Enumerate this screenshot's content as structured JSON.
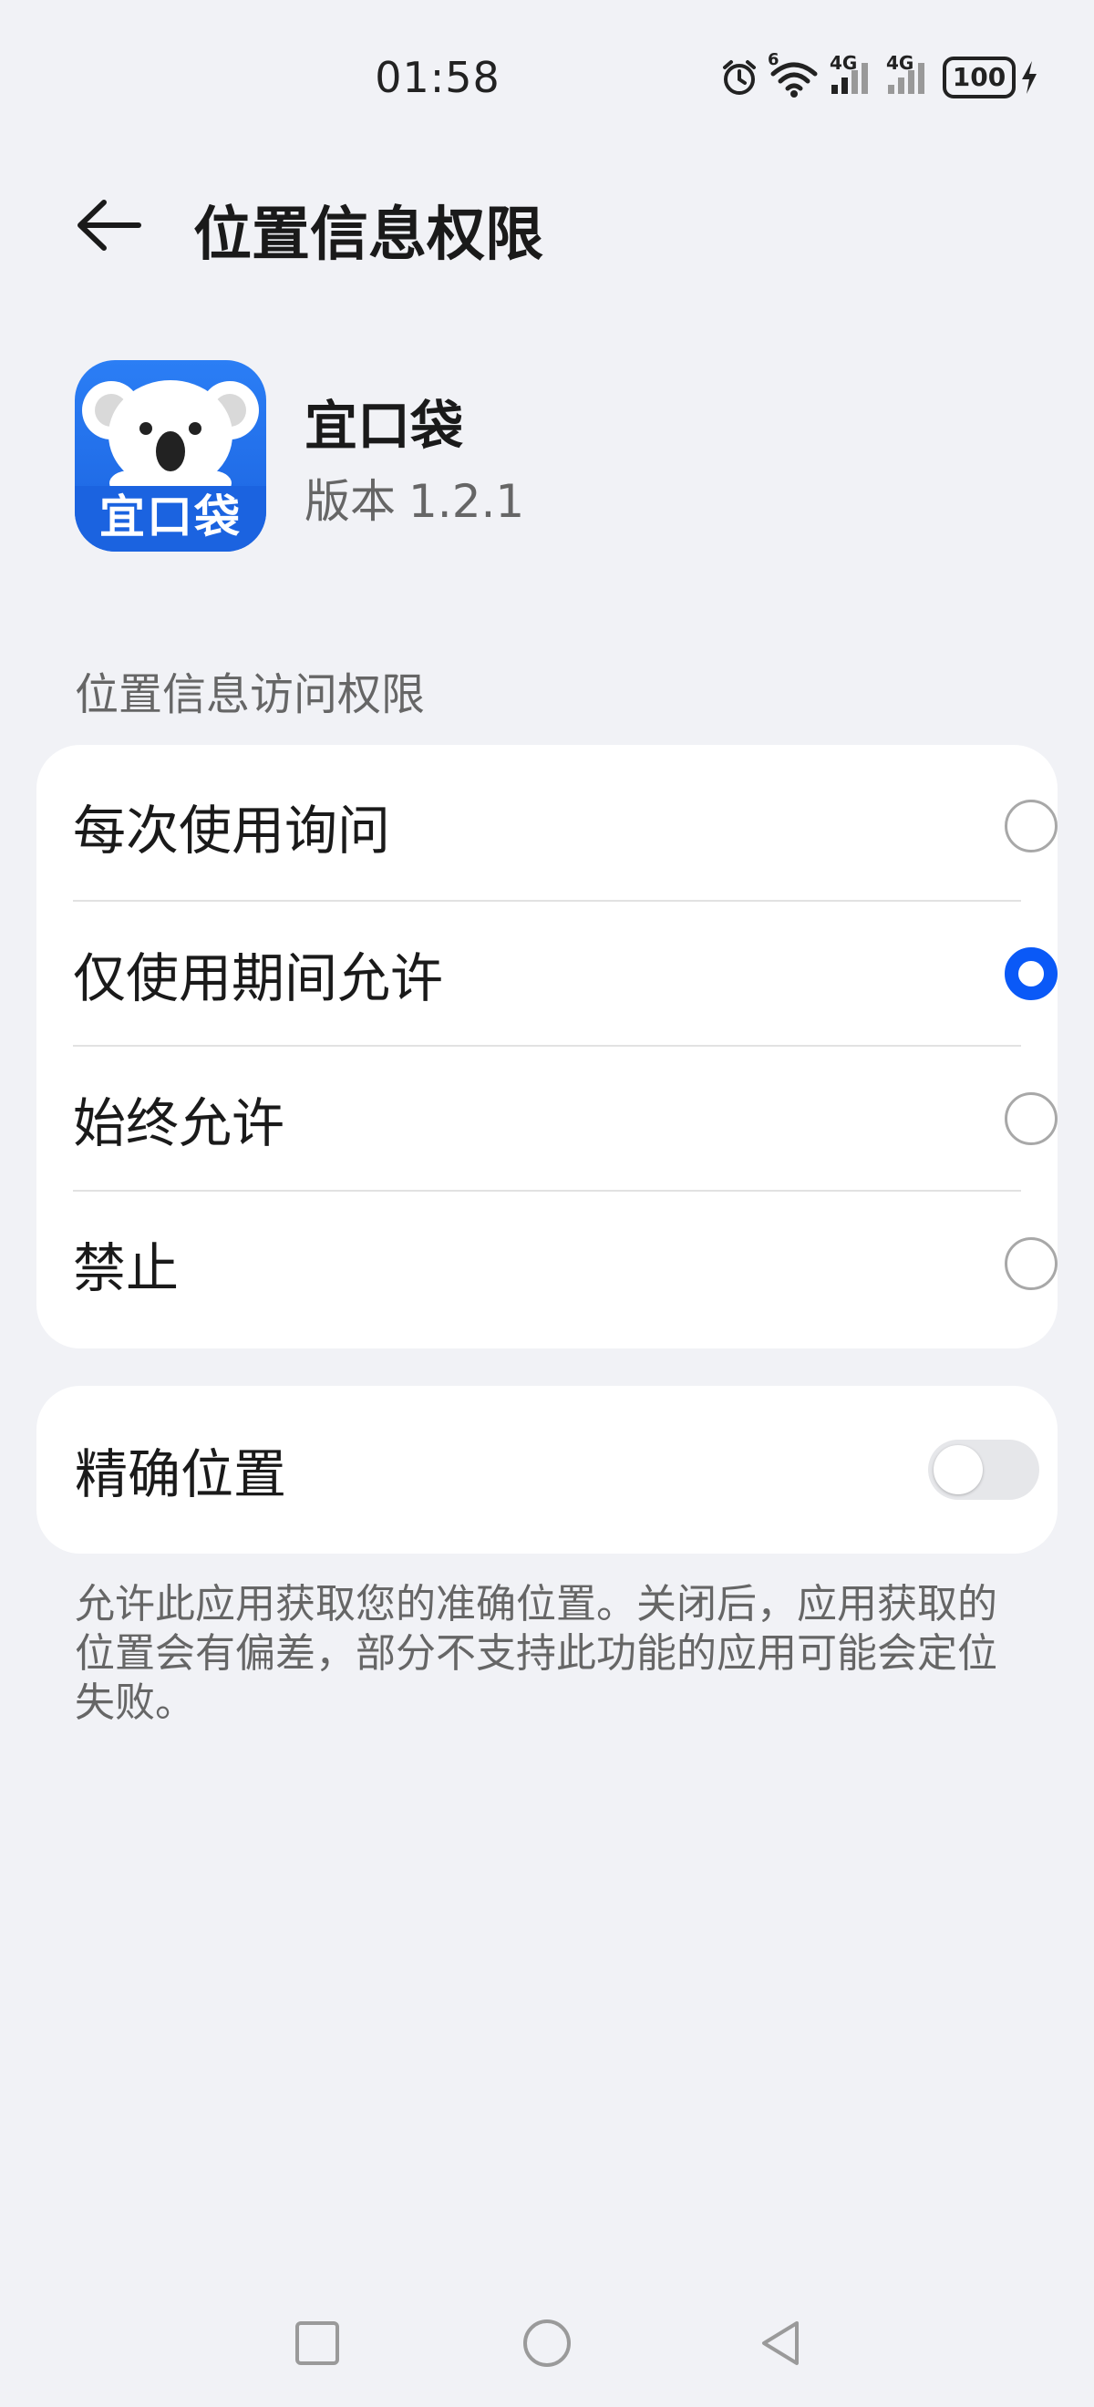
{
  "status_bar": {
    "time": "01:58",
    "battery": "100",
    "network_1": "4G",
    "network_2": "4G",
    "wifi_badge": "6"
  },
  "header": {
    "title": "位置信息权限"
  },
  "app": {
    "name": "宜口袋",
    "icon_text": "宜口袋",
    "version_label": "版本",
    "version": "1.2.1"
  },
  "permission_section": {
    "label": "位置信息访问权限",
    "options": [
      {
        "label": "每次使用询问",
        "selected": false
      },
      {
        "label": "仅使用期间允许",
        "selected": true
      },
      {
        "label": "始终允许",
        "selected": false
      },
      {
        "label": "禁止",
        "selected": false
      }
    ]
  },
  "precise_location": {
    "label": "精确位置",
    "enabled": false,
    "description": "允许此应用获取您的准确位置。关闭后，应用获取的位置会有偏差，部分不支持此功能的应用可能会定位失败。"
  },
  "colors": {
    "accent": "#0a59f7",
    "background": "#f1f2f6",
    "app_icon": "#1b63e0"
  },
  "icons": {
    "back": "back-arrow-icon",
    "alarm": "alarm-icon",
    "wifi": "wifi-icon",
    "signal": "signal-icon",
    "charging": "charging-icon",
    "nav_recent": "square-icon",
    "nav_home": "circle-icon",
    "nav_back": "triangle-back-icon"
  }
}
